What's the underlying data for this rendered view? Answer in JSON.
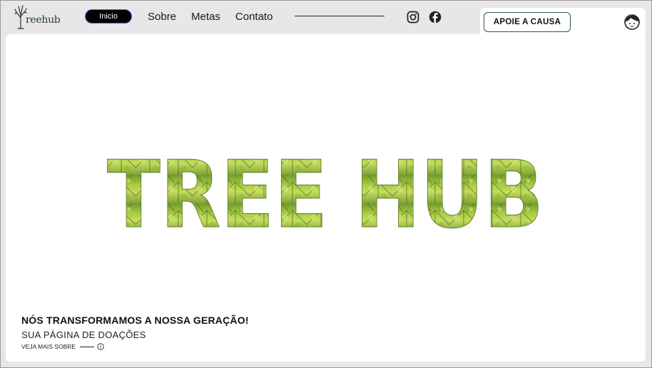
{
  "brand": {
    "logo_text": "reehub",
    "logo_icon": "tree-icon"
  },
  "nav": {
    "items": [
      {
        "label": "Inicio",
        "active": true
      },
      {
        "label": "Sobre",
        "active": false
      },
      {
        "label": "Metas",
        "active": false
      },
      {
        "label": "Contato",
        "active": false
      }
    ]
  },
  "social": {
    "instagram": "instagram-icon",
    "facebook": "facebook-icon"
  },
  "header": {
    "cta_label": "APOIE A CAUSA",
    "avatar_icon": "user-avatar-icon"
  },
  "hero": {
    "title": "TREE HUB",
    "tagline": "NÓS TRANSFORMAMOS A NOSSA GERAÇÃO!",
    "subtitle": "SUA PÁGINA DE DOAÇÕES",
    "more_label": "VEJA MAIS SOBRE",
    "more_icon": "info-icon"
  },
  "colors": {
    "accent": "#2e5a3a",
    "nav_active_bg": "#000000",
    "nav_active_border": "#3a6fd8",
    "leaf_green": "#8fb832"
  }
}
